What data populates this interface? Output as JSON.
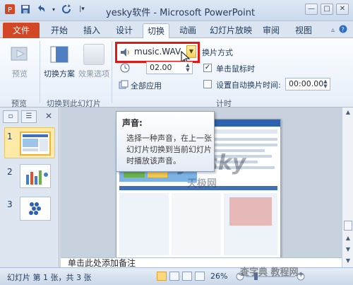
{
  "window": {
    "title": "yesky软件 - Microsoft PowerPoint",
    "controls": {
      "minimize": "—",
      "maximize": "□",
      "close": "✕"
    }
  },
  "quick_access": {
    "icons": [
      "powerpoint-icon",
      "save-icon",
      "undo-icon",
      "redo-icon",
      "customize-icon"
    ]
  },
  "tabs": {
    "file": "文件",
    "items": [
      "开始",
      "插入",
      "设计",
      "切换",
      "动画",
      "幻灯片放映",
      "审阅",
      "视图"
    ],
    "active": "切换"
  },
  "ribbon": {
    "preview": {
      "label": "预览",
      "group": "预览"
    },
    "transition_scheme": {
      "label": "切换方案",
      "group": "切换到此幻灯片"
    },
    "effect_options": {
      "label": "效果选项"
    },
    "sound": {
      "value": "music.WAV"
    },
    "duration": {
      "value": "02.00"
    },
    "apply_all": {
      "label": "全部应用"
    },
    "switch_mode_label": "换片方式",
    "on_click": {
      "label": "单击鼠标时",
      "checked": true
    },
    "auto_after": {
      "label": "设置自动换片时间:",
      "checked": false,
      "value": "00:00.00"
    },
    "timing_group": "计时"
  },
  "tooltip": {
    "title": "声音:",
    "body": "选择一种声音，在上一张幻灯片切换到当前幻灯片时播放该声音。"
  },
  "slides_panel": {
    "slides": [
      {
        "number": "1"
      },
      {
        "number": "2"
      },
      {
        "number": "3"
      }
    ]
  },
  "slide_text": {
    "logo": "yesky",
    "logo_sub": "天极网"
  },
  "notes": {
    "text": "单击此处添加备注"
  },
  "statusbar": {
    "info": "幻灯片 第 1 张，共 3 张",
    "zoom": "26%",
    "zoom_minus": "−",
    "zoom_plus": "+"
  },
  "watermark": "查字典 教程网"
}
